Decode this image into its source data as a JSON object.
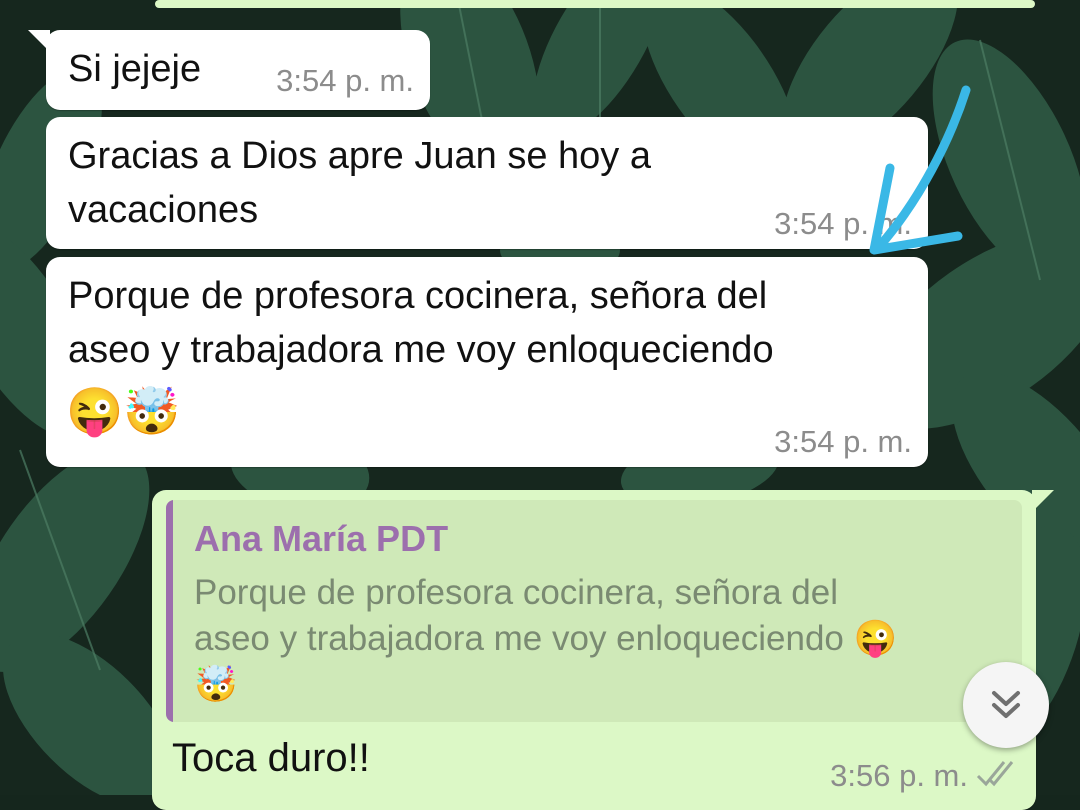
{
  "messages": [
    {
      "text": "Si jejeje",
      "time": "3:54 p. m."
    },
    {
      "text": "Gracias a Dios apre Juan se hoy a\nvacaciones",
      "time": "3:54 p. m."
    },
    {
      "text": "Porque de profesora cocinera, señora del\naseo y trabajadora me voy enloqueciendo",
      "emoji": "😜🤯",
      "time": "3:54 p. m."
    }
  ],
  "reply": {
    "quoted_author": "Ana María PDT",
    "quoted_text": "Porque de profesora cocinera, señora del\naseo y trabajadora me voy enloqueciendo 😜\n🤯",
    "text": "Toca duro!!",
    "time": "3:56 p. m."
  },
  "icons": {
    "scroll_down": "double-chevron-down-icon",
    "read_receipt": "double-check-icon",
    "annotation": "blue-arrow-annotation"
  },
  "colors": {
    "incoming_bubble": "#ffffff",
    "outgoing_bubble": "#dcf8c6",
    "quote_accent": "#9c6fad",
    "annotation_arrow": "#3ab8e6"
  }
}
